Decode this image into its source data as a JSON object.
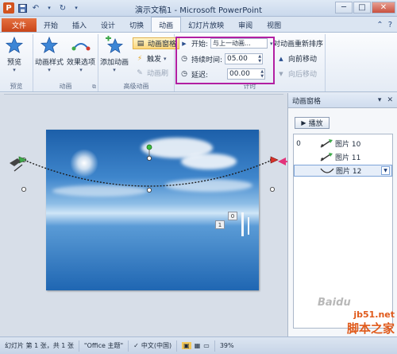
{
  "window": {
    "title": "演示文稿1 - Microsoft PowerPoint",
    "controls": {
      "minimize": "─",
      "maximize": "□",
      "close": "✕"
    }
  },
  "quick_access": {
    "app_icon": "P",
    "save_icon": "disk-icon",
    "undo_icon": "undo-icon",
    "redo_icon": "redo-icon",
    "customize_icon": "caret-icon"
  },
  "tabs": [
    {
      "label": "文件"
    },
    {
      "label": "开始"
    },
    {
      "label": "插入"
    },
    {
      "label": "设计"
    },
    {
      "label": "切换"
    },
    {
      "label": "动画"
    },
    {
      "label": "幻灯片放映"
    },
    {
      "label": "审阅"
    },
    {
      "label": "视图"
    }
  ],
  "ribbon": {
    "preview": {
      "button": "预览",
      "group": "预览"
    },
    "animation": {
      "styles": "动画样式",
      "effect_options": "效果选项",
      "group": "动画"
    },
    "advanced": {
      "add_animation": "添加动画",
      "animation_pane": "动画窗格",
      "trigger": "触发",
      "painter": "动画刷",
      "group": "高级动画"
    },
    "timing": {
      "start_label": "开始:",
      "start_value": "与上一动画...",
      "duration_label": "持续时间:",
      "duration_value": "05.00",
      "delay_label": "延迟:",
      "delay_value": "00.00",
      "reorder_title": "对动画重新排序",
      "move_earlier": "向前移动",
      "move_later": "向后移动",
      "group": "计时"
    }
  },
  "canvas": {
    "chips": [
      "0",
      "1"
    ]
  },
  "anim_pane": {
    "title": "动画窗格",
    "play": "播放",
    "items": [
      {
        "num": "0",
        "label": "图片 10"
      },
      {
        "num": "",
        "label": "图片 11"
      },
      {
        "num": "",
        "label": "图片 12"
      }
    ]
  },
  "statusbar": {
    "slide_info": "幻灯片 第 1 张，共 1 张",
    "theme": "\"Office 主题\"",
    "language": "中文(中国)",
    "zoom": "39%"
  },
  "watermark": {
    "url": "jb51.net",
    "name": "脚本之家",
    "brand": "Baidu"
  },
  "colors": {
    "file_tab": "#d2531f",
    "highlight_box": "#b21fa2",
    "arrow": "#e3337a"
  }
}
